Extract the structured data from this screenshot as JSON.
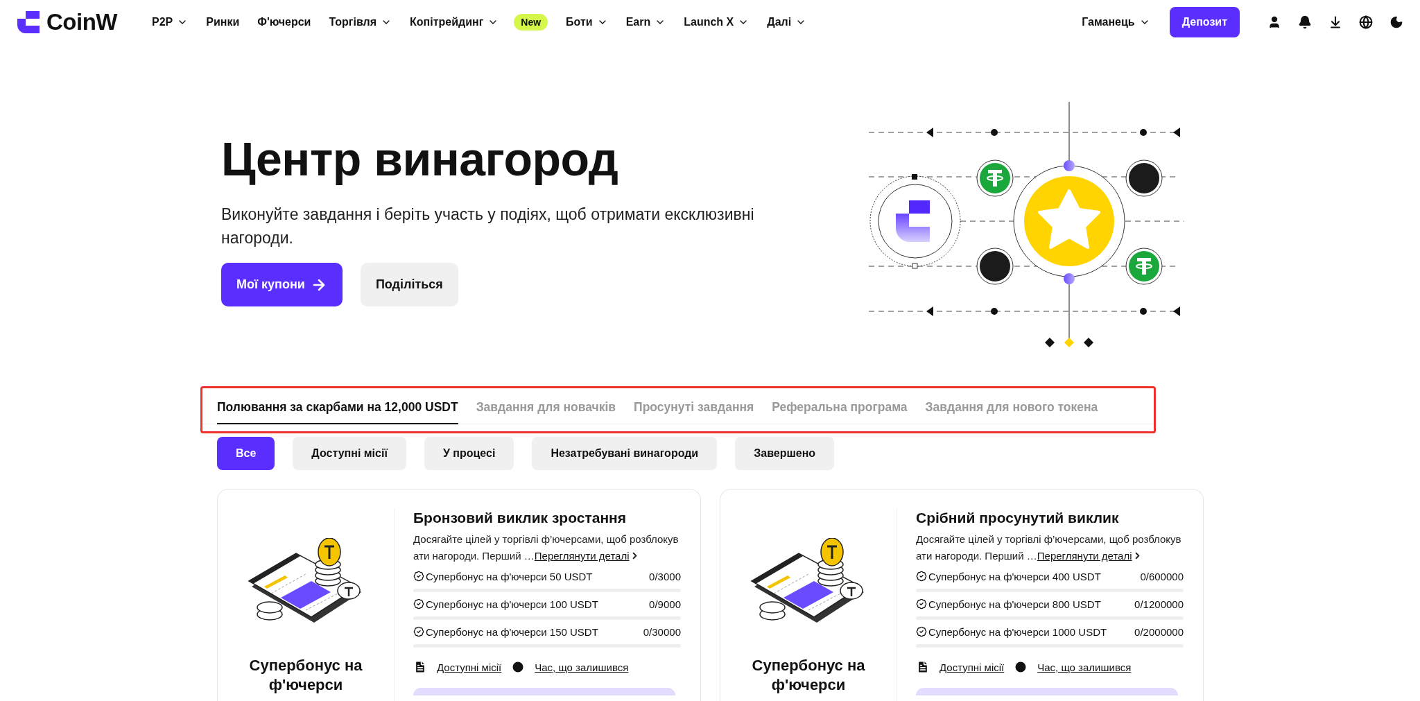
{
  "header": {
    "logo": "CoinW",
    "nav": [
      {
        "label": "P2P",
        "dropdown": true
      },
      {
        "label": "Ринки",
        "dropdown": false
      },
      {
        "label": "Ф'ючерси",
        "dropdown": false
      },
      {
        "label": "Торгівля",
        "dropdown": true
      },
      {
        "label": "Копітрейдинг",
        "dropdown": true,
        "badge": "New"
      },
      {
        "label": "Боти",
        "dropdown": true
      },
      {
        "label": "Earn",
        "dropdown": true
      },
      {
        "label": "Launch X",
        "dropdown": true
      },
      {
        "label": "Далі",
        "dropdown": true
      }
    ],
    "wallet": "Гаманець",
    "deposit": "Депозит"
  },
  "hero": {
    "title": "Центр винагород",
    "subtitle": "Виконуйте завдання і беріть участь у подіях, щоб отримати ексклюзивні нагороди.",
    "buttons": [
      {
        "label": "Мої купони",
        "kind": "primary"
      },
      {
        "label": "Поділіться",
        "kind": "secondary"
      }
    ]
  },
  "tabs": [
    {
      "label": "Полювання за скарбами на 12,000 USDT",
      "selected": true
    },
    {
      "label": "Завдання для новачків",
      "selected": false
    },
    {
      "label": "Просунуті завдання",
      "selected": false
    },
    {
      "label": "Реферальна програма",
      "selected": false
    },
    {
      "label": "Завдання для нового токена",
      "selected": false
    }
  ],
  "filters": [
    {
      "label": "Все",
      "selected": true
    },
    {
      "label": "Доступні місії",
      "selected": false
    },
    {
      "label": "У процесі",
      "selected": false
    },
    {
      "label": "Незатребувані винагороди",
      "selected": false
    },
    {
      "label": "Завершено",
      "selected": false
    }
  ],
  "cards": [
    {
      "category": "Супербонус на ф'ючерси",
      "title": "Бронзовий виклик зростання",
      "description": "Досягайте цілей у торгівлі ф’ючерсами, щоб розблокувати нагороди. Перший …",
      "details_link": "Переглянути деталі",
      "rewards": [
        {
          "label": "Супербонус на ф'ючерси 50 USDT",
          "progress": "0/3000"
        },
        {
          "label": "Супербонус на ф'ючерси 100 USDT",
          "progress": "0/9000"
        },
        {
          "label": "Супербонус на ф'ючерси 150 USDT",
          "progress": "0/30000"
        }
      ],
      "missions_link": "Доступні місії",
      "time_link": "Час, що залишився"
    },
    {
      "category": "Супербонус на ф'ючерси",
      "title": "Срібний просунутий виклик",
      "description": "Досягайте цілей у торгівлі ф’ючерсами, щоб розблокувати нагороди. Перший …",
      "details_link": "Переглянути деталі",
      "rewards": [
        {
          "label": "Супербонус на ф'ючерси 400 USDT",
          "progress": "0/600000"
        },
        {
          "label": "Супербонус на ф'ючерси 800 USDT",
          "progress": "0/1200000"
        },
        {
          "label": "Супербонус на ф'ючерси 1000 USDT",
          "progress": "0/2000000"
        }
      ],
      "missions_link": "Доступні місії",
      "time_link": "Час, що залишився"
    }
  ]
}
